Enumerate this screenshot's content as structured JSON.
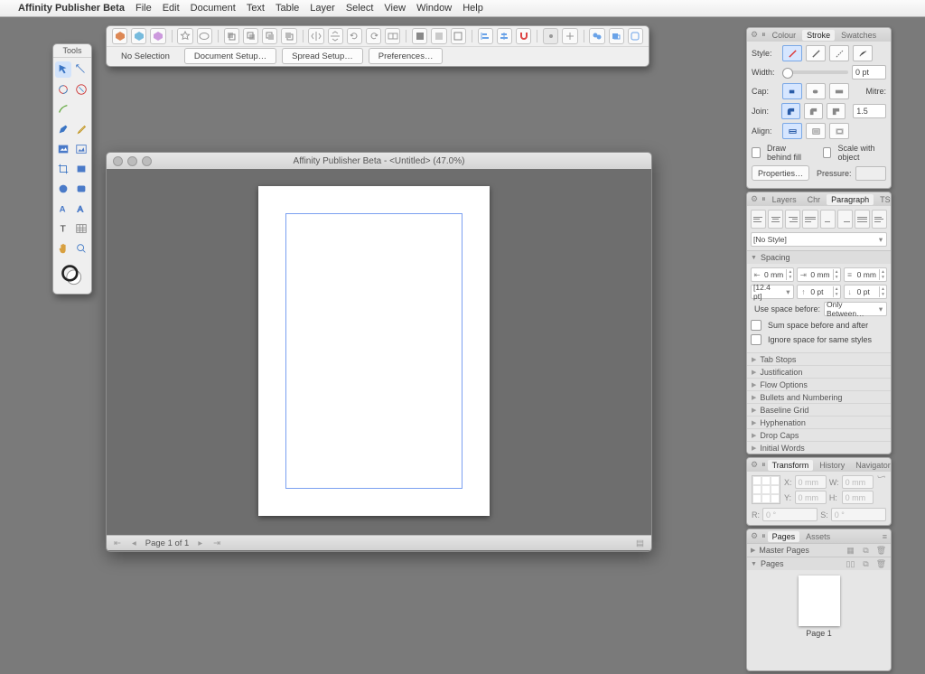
{
  "menubar": {
    "app": "Affinity Publisher Beta",
    "items": [
      "File",
      "Edit",
      "Document",
      "Text",
      "Table",
      "Layer",
      "Select",
      "View",
      "Window",
      "Help"
    ]
  },
  "tools_panel": {
    "title": "Tools"
  },
  "context_toolbar": {
    "status": "No Selection",
    "buttons": {
      "doc_setup": "Document Setup…",
      "spread_setup": "Spread Setup…",
      "preferences": "Preferences…"
    }
  },
  "document_window": {
    "title": "Affinity Publisher Beta - <Untitled> (47.0%)",
    "status": {
      "page": "Page 1 of 1"
    }
  },
  "stroke_panel": {
    "tabs": [
      "Colour",
      "Stroke",
      "Swatches"
    ],
    "labels": {
      "style": "Style:",
      "width": "Width:",
      "cap": "Cap:",
      "join": "Join:",
      "align": "Align:",
      "mitre": "Mitre:"
    },
    "width_value": "0 pt",
    "mitre_value": "1.5",
    "draw_behind": "Draw behind fill",
    "scale_with": "Scale with object",
    "properties_btn": "Properties…",
    "pressure_label": "Pressure:"
  },
  "paragraph_panel": {
    "tabs": [
      "Layers",
      "Chr",
      "Paragraph",
      "TSt"
    ],
    "style_dropdown": "[No Style]",
    "spacing_header": "Spacing",
    "spacing": {
      "left": "0 mm",
      "right": "0 mm",
      "first": "0 mm",
      "leading": "[12.4 pt]",
      "before": "0 pt",
      "after": "0 pt"
    },
    "use_space_before_label": "Use space before:",
    "use_space_before_value": "Only Between…",
    "sum_space": "Sum space before and after",
    "ignore_space": "Ignore space for same styles",
    "accordions": [
      "Tab Stops",
      "Justification",
      "Flow Options",
      "Bullets and Numbering",
      "Baseline Grid",
      "Hyphenation",
      "Drop Caps",
      "Initial Words"
    ]
  },
  "transform_panel": {
    "tabs": [
      "Transform",
      "History",
      "Navigator"
    ],
    "labels": {
      "x": "X:",
      "y": "Y:",
      "w": "W:",
      "h": "H:",
      "r": "R:",
      "s": "S:"
    },
    "placeholder": "0 mm",
    "rot_placeholder": "0 °"
  },
  "pages_panel": {
    "tabs": [
      "Pages",
      "Assets"
    ],
    "master": "Master Pages",
    "pages_header": "Pages",
    "page_label": "Page 1"
  }
}
